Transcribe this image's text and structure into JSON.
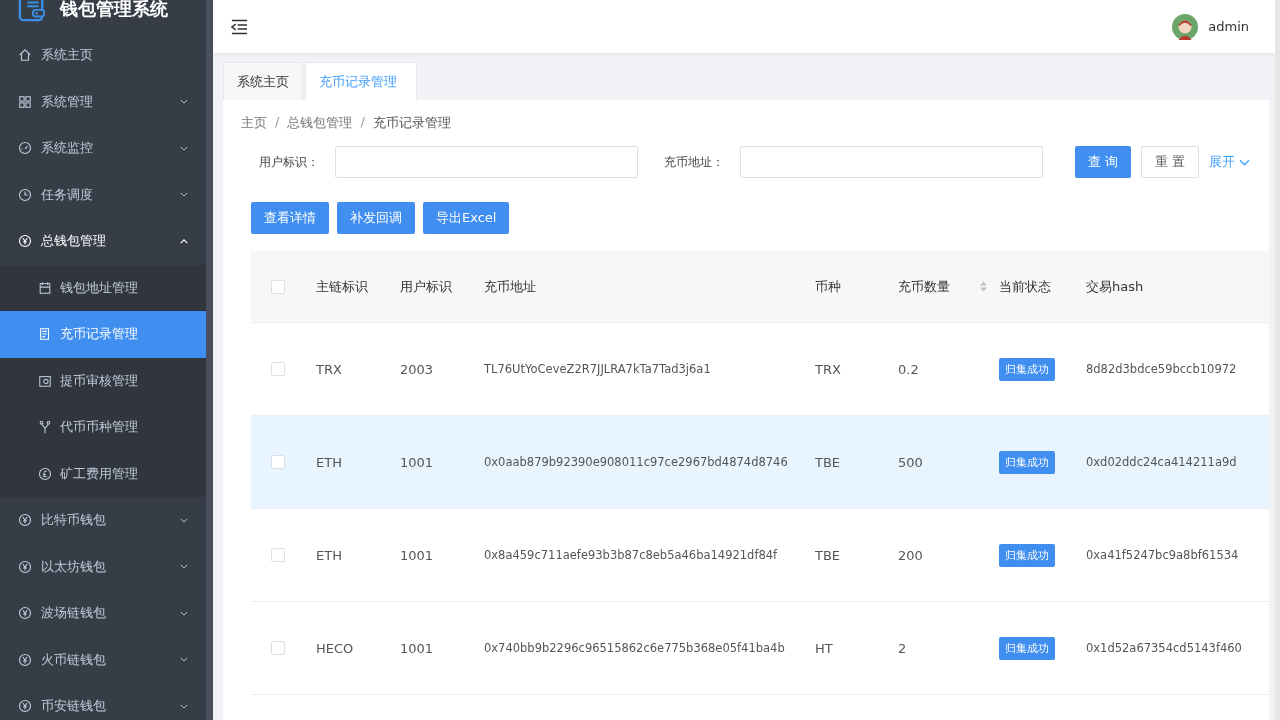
{
  "sidebar": {
    "title": "钱包管理系统",
    "items": [
      {
        "label": "系统主页",
        "selected": false
      },
      {
        "label": "系统管理",
        "expanded": false,
        "selected": false
      },
      {
        "label": "系统监控",
        "expanded": false,
        "selected": false
      },
      {
        "label": "任务调度",
        "expanded": false,
        "selected": false
      },
      {
        "label": "总钱包管理",
        "expanded": true,
        "selected": false,
        "children": [
          {
            "label": "钱包地址管理",
            "selected": false
          },
          {
            "label": "充币记录管理",
            "selected": true
          },
          {
            "label": "提币审核管理",
            "selected": false
          },
          {
            "label": "代币币种管理",
            "selected": false
          },
          {
            "label": "矿工费用管理",
            "selected": false
          }
        ]
      },
      {
        "label": "比特币钱包",
        "expanded": false,
        "selected": false
      },
      {
        "label": "以太坊钱包",
        "expanded": false,
        "selected": false
      },
      {
        "label": "波场链钱包",
        "expanded": false,
        "selected": false
      },
      {
        "label": "火币链钱包",
        "expanded": false,
        "selected": false
      },
      {
        "label": "币安链钱包",
        "expanded": false,
        "selected": false
      }
    ]
  },
  "header": {
    "user": "admin"
  },
  "tabs": [
    {
      "label": "系统主页",
      "selected": false
    },
    {
      "label": "充币记录管理",
      "selected": true
    }
  ],
  "breadcrumb": {
    "separator": "/",
    "items": [
      "主页",
      "总钱包管理",
      "充币记录管理"
    ]
  },
  "filters": [
    {
      "label": "用户标识："
    },
    {
      "label": "充币地址："
    }
  ],
  "search_buttons": [
    {
      "label": "查 询",
      "kind": "primary"
    },
    {
      "label": "重 置",
      "kind": "default"
    },
    {
      "label": "展开",
      "kind": "link"
    }
  ],
  "actions": [
    "查看详情",
    "补发回调",
    "导出Excel"
  ],
  "table": {
    "all_checked": false,
    "columns": [
      {
        "label": "主链标识",
        "sortable": false
      },
      {
        "label": "用户标识",
        "sortable": false
      },
      {
        "label": "充币地址",
        "sortable": false
      },
      {
        "label": "币种",
        "sortable": false
      },
      {
        "label": "充币数量",
        "sortable": true
      },
      {
        "label": "当前状态",
        "sortable": false
      },
      {
        "label": "交易hash",
        "sortable": false
      }
    ],
    "rows": [
      {
        "checked": false,
        "selected": false,
        "cells": [
          "TRX",
          "2003",
          "TL76UtYoCeveZ2R7JJLRA7kTa7Tad3j6a1",
          "TRX",
          "0.2",
          "归集成功",
          "8d82d3bdce59bccb10972"
        ]
      },
      {
        "checked": false,
        "selected": true,
        "cells": [
          "ETH",
          "1001",
          "0x0aab879b92390e908011c97ce2967bd4874d8746",
          "TBE",
          "500",
          "归集成功",
          "0xd02ddc24ca414211a9d"
        ]
      },
      {
        "checked": false,
        "selected": false,
        "cells": [
          "ETH",
          "1001",
          "0x8a459c711aefe93b3b87c8eb5a46ba14921df84f",
          "TBE",
          "200",
          "归集成功",
          "0xa41f5247bc9a8bf61534"
        ]
      },
      {
        "checked": false,
        "selected": false,
        "cells": [
          "HECO",
          "1001",
          "0x740bb9b2296c96515862c6e775b368e05f41ba4b",
          "HT",
          "2",
          "归集成功",
          "0x1d52a67354cd5143f460"
        ]
      }
    ]
  }
}
